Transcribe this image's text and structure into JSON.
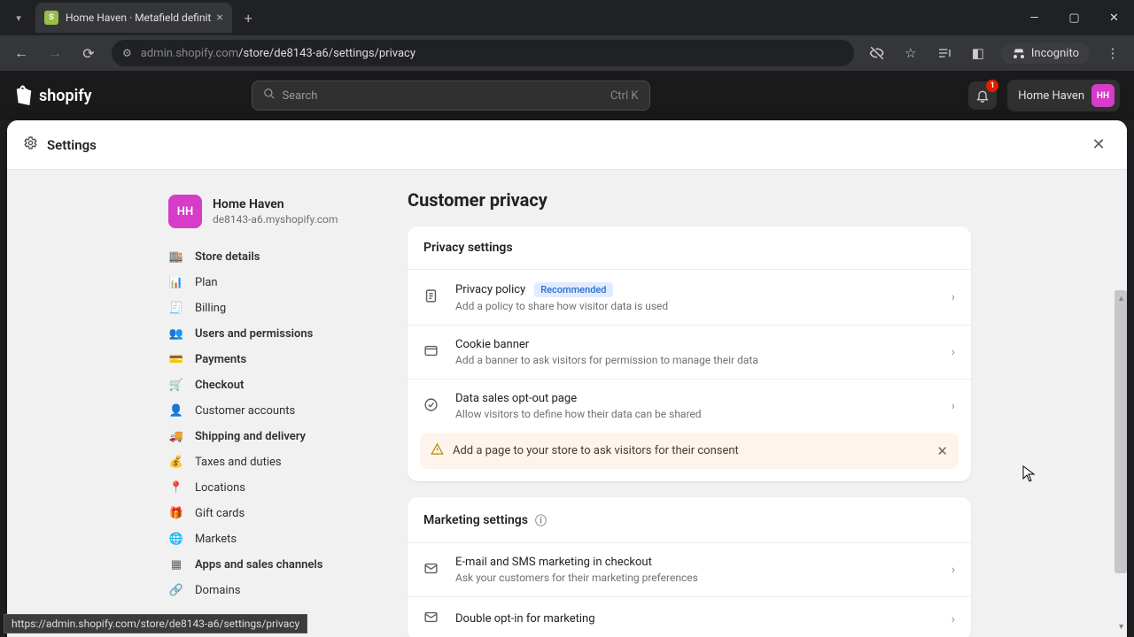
{
  "browser": {
    "tab_title": "Home Haven · Metafield definit",
    "url_display": "admin.shopify.com/store/de8143-a6/settings/privacy",
    "url_host": "admin.shopify.com",
    "url_path": "/store/de8143-a6/settings/privacy",
    "incognito": "Incognito",
    "url_tooltip": "https://admin.shopify.com/store/de8143-a6/settings/privacy"
  },
  "shop": {
    "logo_text": "shopify",
    "search_placeholder": "Search",
    "search_shortcut": "Ctrl K",
    "bell_count": "1",
    "store_name": "Home Haven",
    "avatar": "HH"
  },
  "settings_header": {
    "title": "Settings"
  },
  "store_card": {
    "avatar": "HH",
    "name": "Home Haven",
    "domain": "de8143-a6.myshopify.com"
  },
  "nav": [
    {
      "icon": "🏬",
      "label": "Store details",
      "bold": true
    },
    {
      "icon": "📊",
      "label": "Plan"
    },
    {
      "icon": "🧾",
      "label": "Billing"
    },
    {
      "icon": "👥",
      "label": "Users and permissions",
      "bold": true
    },
    {
      "icon": "💳",
      "label": "Payments",
      "bold": true
    },
    {
      "icon": "🛒",
      "label": "Checkout",
      "bold": true
    },
    {
      "icon": "👤",
      "label": "Customer accounts"
    },
    {
      "icon": "🚚",
      "label": "Shipping and delivery",
      "bold": true
    },
    {
      "icon": "💰",
      "label": "Taxes and duties"
    },
    {
      "icon": "📍",
      "label": "Locations"
    },
    {
      "icon": "🎁",
      "label": "Gift cards"
    },
    {
      "icon": "🌐",
      "label": "Markets"
    },
    {
      "icon": "▦",
      "label": "Apps and sales channels",
      "bold": true
    },
    {
      "icon": "🔗",
      "label": "Domains"
    }
  ],
  "page": {
    "title": "Customer privacy"
  },
  "privacy_card": {
    "title": "Privacy settings",
    "rows": [
      {
        "title": "Privacy policy",
        "badge": "Recommended",
        "sub": "Add a policy to share how visitor data is used"
      },
      {
        "title": "Cookie banner",
        "sub": "Add a banner to ask visitors for permission to manage their data"
      },
      {
        "title": "Data sales opt-out page",
        "sub": "Allow visitors to define how their data can be shared"
      }
    ],
    "banner": "Add a page to your store to ask visitors for their consent"
  },
  "marketing_card": {
    "title": "Marketing settings",
    "rows": [
      {
        "title": "E-mail and SMS marketing in checkout",
        "sub": "Ask your customers for their marketing preferences"
      },
      {
        "title": "Double opt-in for marketing",
        "sub": ""
      }
    ]
  }
}
